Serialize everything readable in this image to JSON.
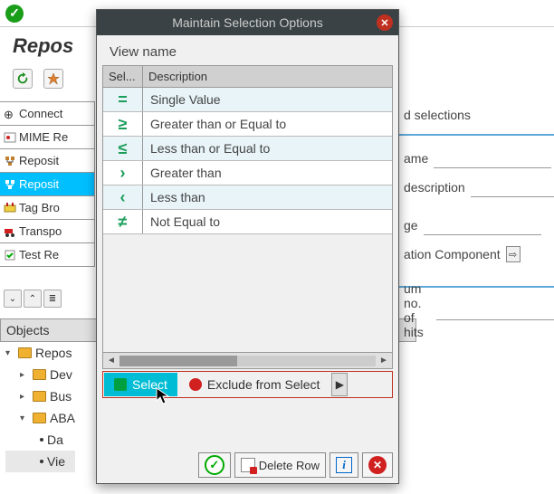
{
  "bg": {
    "title": "Repos",
    "tree": [
      {
        "label": "Connect",
        "active": false
      },
      {
        "label": "MIME Re",
        "active": false
      },
      {
        "label": "Reposit",
        "active": false
      },
      {
        "label": "Reposit",
        "active": true
      },
      {
        "label": "Tag Bro",
        "active": false
      },
      {
        "label": "Transpo",
        "active": false
      },
      {
        "label": "Test Re",
        "active": false
      }
    ],
    "objects_header": "Objects",
    "objects": [
      {
        "label": "Repos",
        "expanded": true,
        "depth": 0
      },
      {
        "label": "Dev",
        "expanded": false,
        "depth": 1
      },
      {
        "label": "Bus",
        "expanded": false,
        "depth": 1
      },
      {
        "label": "ABA",
        "expanded": true,
        "depth": 1
      },
      {
        "label": "Da",
        "expanded": null,
        "depth": 2
      },
      {
        "label": "Vie",
        "expanded": null,
        "depth": 2
      }
    ],
    "right": {
      "sel_header": "d selections",
      "name": "ame",
      "desc": "description",
      "pkg": "ge",
      "appcomp": "ation Component",
      "maxhits": "um no. of hits"
    }
  },
  "dialog": {
    "title": "Maintain Selection Options",
    "view_label": "View name",
    "col_sel": "Sel...",
    "col_desc": "Description",
    "options": [
      {
        "icon": "=",
        "label": "Single Value"
      },
      {
        "icon": "≥",
        "label": "Greater than or Equal to"
      },
      {
        "icon": "≤",
        "label": "Less than or Equal to"
      },
      {
        "icon": "›",
        "label": "Greater than"
      },
      {
        "icon": "‹",
        "label": "Less than"
      },
      {
        "icon": "≠",
        "label": "Not Equal to"
      }
    ],
    "tabs": {
      "select": "Select",
      "exclude": "Exclude from Select"
    },
    "footer": {
      "delete_row": "Delete Row"
    }
  }
}
